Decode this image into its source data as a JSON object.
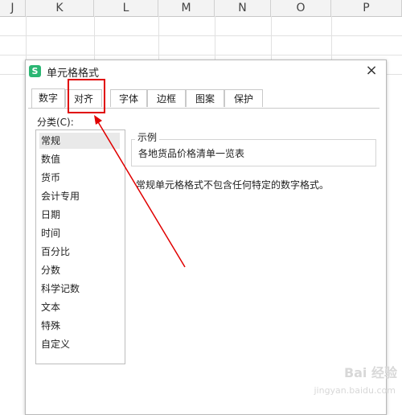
{
  "spreadsheet": {
    "columns": [
      "J",
      "K",
      "L",
      "M",
      "N",
      "O",
      "P"
    ]
  },
  "dialog": {
    "title": "单元格格式",
    "close_glyph": "×",
    "app_icon_letter": "S",
    "tabs": [
      "数字",
      "对齐",
      "字体",
      "边框",
      "图案",
      "保护"
    ],
    "active_tab": "数字",
    "category_label": "分类(C):",
    "categories": [
      "常规",
      "数值",
      "货币",
      "会计专用",
      "日期",
      "时间",
      "百分比",
      "分数",
      "科学记数",
      "文本",
      "特殊",
      "自定义"
    ],
    "selected_category": "常规",
    "sample_legend": "示例",
    "sample_text": "各地货品价格清单一览表",
    "description": "常规单元格格式不包含任何特定的数字格式。"
  },
  "annotation": {
    "highlight_color": "#e00000",
    "highlighted_tab": "对齐"
  },
  "watermark": {
    "brand": "Bai 经验",
    "url": "jingyan.baidu.com"
  }
}
